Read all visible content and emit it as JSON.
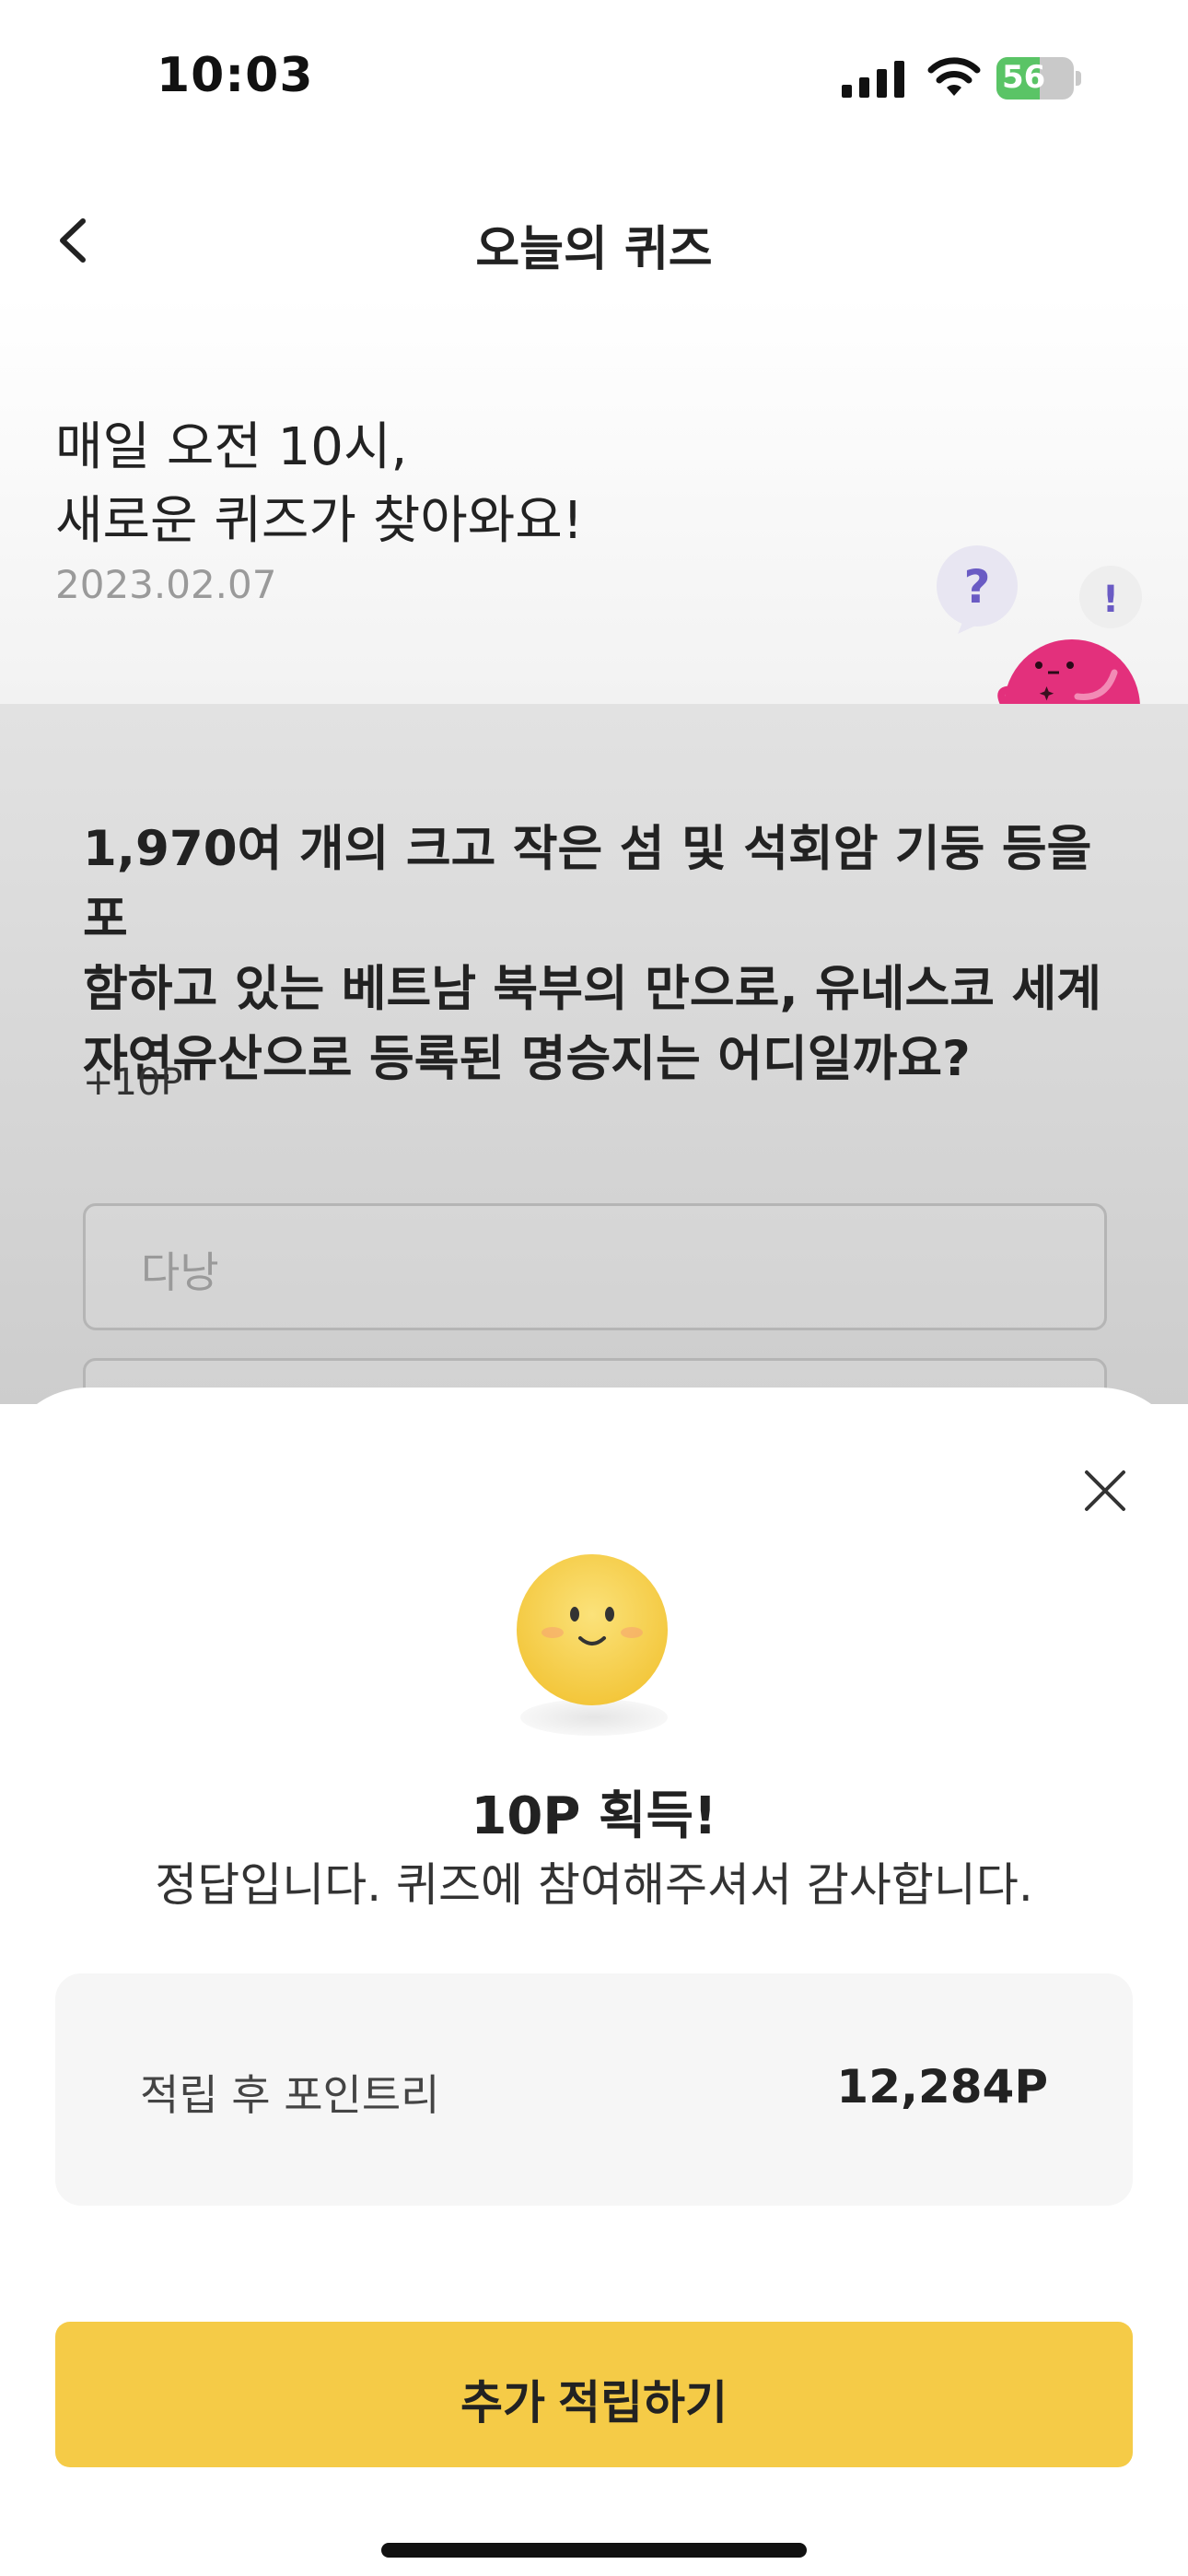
{
  "status_bar": {
    "time": "10:03",
    "battery_level": "56",
    "battery_fraction": 0.56
  },
  "header": {
    "title": "오늘의 퀴즈",
    "back_icon": "chevron-left-icon"
  },
  "intro": {
    "line1": "매일 오전 10시,",
    "line2": "새로운 퀴즈가 찾아와요!",
    "date": "2023.02.07",
    "mascot_marks": [
      "?",
      "!"
    ]
  },
  "quiz": {
    "question_lines": [
      "1,970여 개의 크고 작은 섬 및 석회암 기둥 등을 포",
      "함하고 있는 베트남 북부의 만으로, 유네스코 세계",
      "자연유산으로 등록된 명승지는 어디일까요?"
    ],
    "reward": "+10P",
    "options": [
      "다낭",
      ""
    ]
  },
  "result_sheet": {
    "title": "10P 획득!",
    "message": "정답입니다. 퀴즈에 참여해주셔서 감사합니다.",
    "points_label": "적립 후 포인트리",
    "points_value": "12,284P",
    "cta_label": "추가 적립하기",
    "accent_color": "#F5CB47"
  }
}
